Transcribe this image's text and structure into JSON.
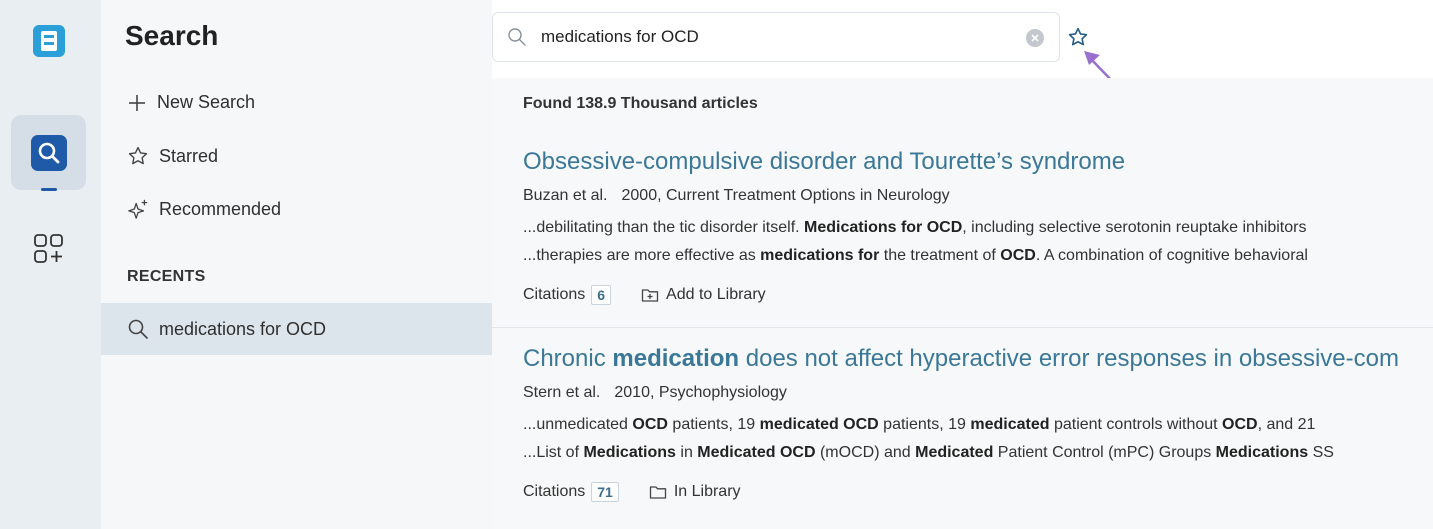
{
  "sidebar": {
    "title": "Search",
    "new_search": "New Search",
    "starred": "Starred",
    "recommended": "Recommended",
    "recents_header": "RECENTS",
    "recents": [
      {
        "label": "medications for OCD"
      }
    ]
  },
  "search": {
    "query": "medications for OCD"
  },
  "results": {
    "found_text": "Found 138.9 Thousand articles",
    "items": [
      {
        "title_parts": [
          "Obsessive-compulsive disorder and Tourette’s syndrome"
        ],
        "authors": "Buzan et al.",
        "year_source": "2000, Current Treatment Options in Neurology",
        "snippet1": [
          {
            "t": "...debilitating than the tic disorder itself. ",
            "b": false
          },
          {
            "t": "Medications for OCD",
            "b": true
          },
          {
            "t": ", including selective serotonin reuptake inhibitors",
            "b": false
          }
        ],
        "snippet2": [
          {
            "t": "...therapies are more effective as ",
            "b": false
          },
          {
            "t": "medications for",
            "b": true
          },
          {
            "t": " the treatment of ",
            "b": false
          },
          {
            "t": "OCD",
            "b": true
          },
          {
            "t": ". A combination of cognitive behavioral",
            "b": false
          }
        ],
        "citations_label": "Citations",
        "citations": "6",
        "library_label": "Add to Library"
      },
      {
        "title_parts": [
          "Chronic ",
          "medication",
          " does not affect hyperactive error responses in obsessive-com"
        ],
        "authors": "Stern et al.",
        "year_source": "2010, Psychophysiology",
        "snippet1": [
          {
            "t": "...unmedicated ",
            "b": false
          },
          {
            "t": "OCD",
            "b": true
          },
          {
            "t": " patients, 19 ",
            "b": false
          },
          {
            "t": "medicated OCD",
            "b": true
          },
          {
            "t": " patients, 19 ",
            "b": false
          },
          {
            "t": "medicated",
            "b": true
          },
          {
            "t": " patient controls without ",
            "b": false
          },
          {
            "t": "OCD",
            "b": true
          },
          {
            "t": ", and 21",
            "b": false
          }
        ],
        "snippet2": [
          {
            "t": "...List of ",
            "b": false
          },
          {
            "t": "Medications",
            "b": true
          },
          {
            "t": " in ",
            "b": false
          },
          {
            "t": "Medicated OCD",
            "b": true
          },
          {
            "t": " (mOCD) and ",
            "b": false
          },
          {
            "t": "Medicated",
            "b": true
          },
          {
            "t": " Patient Control (mPC) Groups ",
            "b": false
          },
          {
            "t": "Medications",
            "b": true
          },
          {
            "t": " SS",
            "b": false
          }
        ],
        "citations_label": "Citations",
        "citations": "71",
        "library_label": "In Library"
      }
    ]
  },
  "icons": {
    "logo": "app-logo-icon",
    "search": "search-icon",
    "apps": "apps-add-icon",
    "star": "star-icon",
    "clear": "clear-icon"
  },
  "colors": {
    "accent": "#1e5aa8",
    "link": "#3b7897",
    "annotation": "#9b6fcf"
  }
}
